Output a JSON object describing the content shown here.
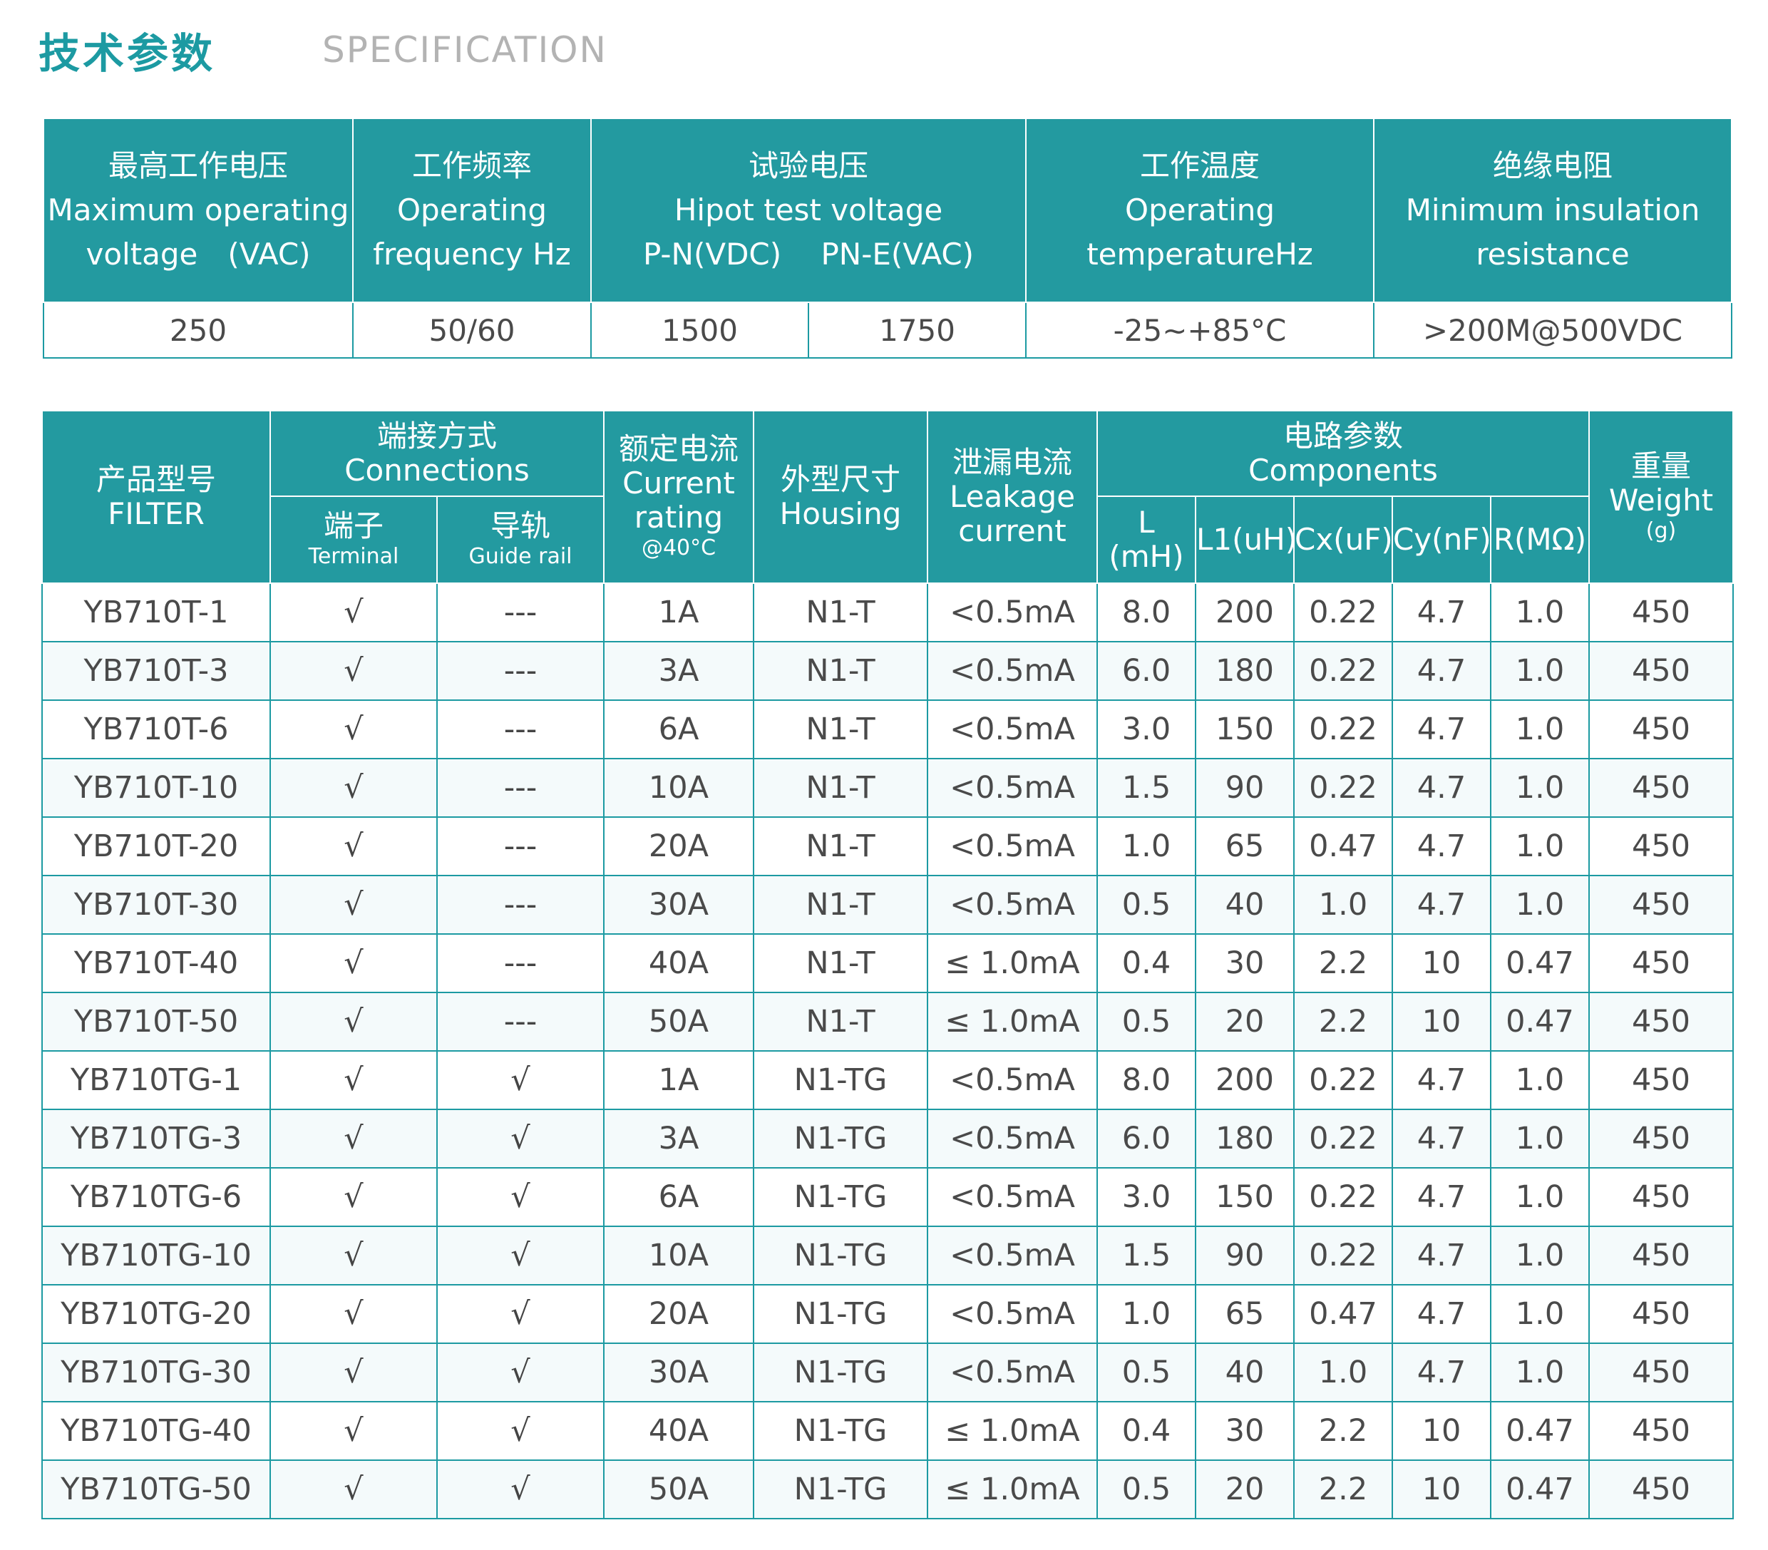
{
  "heading": {
    "cn": "技术参数",
    "en": "SPECIFICATION"
  },
  "spec": {
    "headers": [
      {
        "cn": "最高工作电压",
        "en": "Maximum operating",
        "en2": "voltage　(VAC)"
      },
      {
        "cn": "工作频率",
        "en": "Operating",
        "en2": "frequency Hz"
      },
      {
        "cn": "试验电压",
        "en": "Hipot test voltage",
        "en2": "P-N(VDC)　 PN-E(VAC)"
      },
      {
        "cn": "工作温度",
        "en": "Operating",
        "en2": "temperatureHz"
      },
      {
        "cn": "绝缘电阻",
        "en": "Minimum insulation",
        "en2": "resistance"
      }
    ],
    "values": [
      "250",
      "50/60",
      "1500",
      "1750",
      "-25~+85°C",
      ">200M@500VDC"
    ]
  },
  "product": {
    "headers": {
      "model": {
        "cn": "产品型号",
        "en": "FILTER"
      },
      "connections": {
        "cn": "端接方式",
        "en": "Connections"
      },
      "terminal": {
        "cn": "端子",
        "en": "Terminal"
      },
      "guide": {
        "cn": "导轨",
        "en": "Guide rail"
      },
      "current": {
        "cn": "额定电流",
        "en": "Current",
        "en2": "rating",
        "note": "@40°C"
      },
      "housing": {
        "cn": "外型尺寸",
        "en": "Housing"
      },
      "leakage": {
        "cn": "泄漏电流",
        "en": "Leakage",
        "en2": "current"
      },
      "components": {
        "cn": "电路参数",
        "en": "Components"
      },
      "l": "L (mH)",
      "l1": "L1(uH)",
      "cx": "Cx(uF)",
      "cy": "Cy(nF)",
      "r": "R(MΩ)",
      "weight": {
        "cn": "重量",
        "en": "Weight",
        "unit": "(g)"
      }
    },
    "rows": [
      [
        "YB710T-1",
        "√",
        "---",
        "1A",
        "N1-T",
        "<0.5mA",
        "8.0",
        "200",
        "0.22",
        "4.7",
        "1.0",
        "450"
      ],
      [
        "YB710T-3",
        "√",
        "---",
        "3A",
        "N1-T",
        "<0.5mA",
        "6.0",
        "180",
        "0.22",
        "4.7",
        "1.0",
        "450"
      ],
      [
        "YB710T-6",
        "√",
        "---",
        "6A",
        "N1-T",
        "<0.5mA",
        "3.0",
        "150",
        "0.22",
        "4.7",
        "1.0",
        "450"
      ],
      [
        "YB710T-10",
        "√",
        "---",
        "10A",
        "N1-T",
        "<0.5mA",
        "1.5",
        "90",
        "0.22",
        "4.7",
        "1.0",
        "450"
      ],
      [
        "YB710T-20",
        "√",
        "---",
        "20A",
        "N1-T",
        "<0.5mA",
        "1.0",
        "65",
        "0.47",
        "4.7",
        "1.0",
        "450"
      ],
      [
        "YB710T-30",
        "√",
        "---",
        "30A",
        "N1-T",
        "<0.5mA",
        "0.5",
        "40",
        "1.0",
        "4.7",
        "1.0",
        "450"
      ],
      [
        "YB710T-40",
        "√",
        "---",
        "40A",
        "N1-T",
        "≤ 1.0mA",
        "0.4",
        "30",
        "2.2",
        "10",
        "0.47",
        "450"
      ],
      [
        "YB710T-50",
        "√",
        "---",
        "50A",
        "N1-T",
        "≤ 1.0mA",
        "0.5",
        "20",
        "2.2",
        "10",
        "0.47",
        "450"
      ],
      [
        "YB710TG-1",
        "√",
        "√",
        "1A",
        "N1-TG",
        "<0.5mA",
        "8.0",
        "200",
        "0.22",
        "4.7",
        "1.0",
        "450"
      ],
      [
        "YB710TG-3",
        "√",
        "√",
        "3A",
        "N1-TG",
        "<0.5mA",
        "6.0",
        "180",
        "0.22",
        "4.7",
        "1.0",
        "450"
      ],
      [
        "YB710TG-6",
        "√",
        "√",
        "6A",
        "N1-TG",
        "<0.5mA",
        "3.0",
        "150",
        "0.22",
        "4.7",
        "1.0",
        "450"
      ],
      [
        "YB710TG-10",
        "√",
        "√",
        "10A",
        "N1-TG",
        "<0.5mA",
        "1.5",
        "90",
        "0.22",
        "4.7",
        "1.0",
        "450"
      ],
      [
        "YB710TG-20",
        "√",
        "√",
        "20A",
        "N1-TG",
        "<0.5mA",
        "1.0",
        "65",
        "0.47",
        "4.7",
        "1.0",
        "450"
      ],
      [
        "YB710TG-30",
        "√",
        "√",
        "30A",
        "N1-TG",
        "<0.5mA",
        "0.5",
        "40",
        "1.0",
        "4.7",
        "1.0",
        "450"
      ],
      [
        "YB710TG-40",
        "√",
        "√",
        "40A",
        "N1-TG",
        "≤ 1.0mA",
        "0.4",
        "30",
        "2.2",
        "10",
        "0.47",
        "450"
      ],
      [
        "YB710TG-50",
        "√",
        "√",
        "50A",
        "N1-TG",
        "≤ 1.0mA",
        "0.5",
        "20",
        "2.2",
        "10",
        "0.47",
        "450"
      ]
    ]
  }
}
